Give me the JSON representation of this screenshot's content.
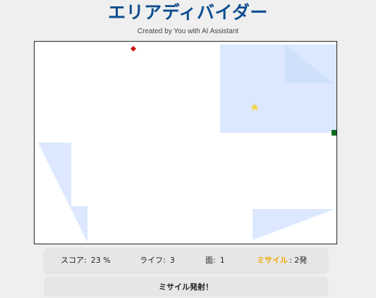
{
  "app": {
    "title": "エリアディバイダー",
    "subtitle": "Created by You with AI Assistant"
  },
  "colors": {
    "title": "#0f4d8f",
    "claimed_area": "#dbe8ff",
    "claimed_area_inner": "#cfe0fb",
    "player": "#0a6b1f",
    "enemy": "#cc1111",
    "star": "#f2d44a",
    "missile_label": "#f0a500"
  },
  "stats": {
    "score_label": "スコア:",
    "score_value": "23 %",
    "lives_label": "ライフ:",
    "lives_value": "3",
    "stage_label": "面:",
    "stage_value": "1",
    "missile_label": "ミサイル",
    "missile_value": ": 2発"
  },
  "actions": {
    "fire_label": "ミサイル発射！"
  },
  "board": {
    "icons": {
      "player": "player-marker-icon",
      "enemy": "enemy-diamond-icon",
      "item": "star-icon"
    }
  }
}
